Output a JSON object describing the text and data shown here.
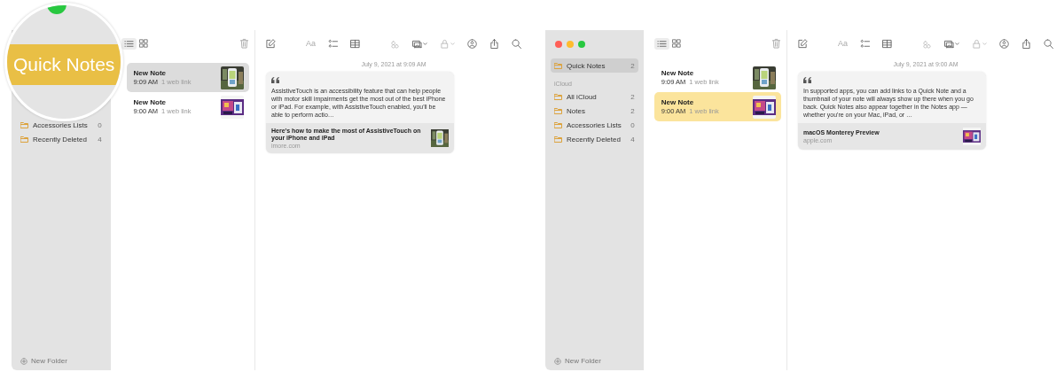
{
  "windows": [
    {
      "focused": false,
      "window_controls": false,
      "magnifier": {
        "label": "Quick Notes"
      },
      "sidebar": {
        "items": [
          {
            "kind": "folder",
            "label": "Accessories Lists",
            "count": "0",
            "selected": false
          },
          {
            "kind": "folder",
            "label": "Recently Deleted",
            "count": "4",
            "selected": false
          }
        ],
        "new_folder": "New Folder"
      },
      "note_list": {
        "list_view_selected": true,
        "notes": [
          {
            "title": "New Note",
            "time": "9:09 AM",
            "meta": "1 web link",
            "selected": true
          },
          {
            "title": "New Note",
            "time": "9:00 AM",
            "meta": "1 web link",
            "selected": false
          }
        ]
      },
      "editor": {
        "format_label": "Aa",
        "date": "July 9, 2021 at 9:09 AM",
        "card": {
          "excerpt": "AssistiveTouch is an accessibility feature that can help people with motor skill impairments get the most out of the best iPhone or iPad. For example, with AssistiveTouch enabled, you'll be able to perform actio…",
          "title": "Here's how to make the most of AssistiveTouch on your iPhone and iPad",
          "domain": "imore.com"
        }
      }
    },
    {
      "focused": true,
      "window_controls": true,
      "sidebar": {
        "items": [
          {
            "kind": "folder",
            "label": "Quick Notes",
            "count": "2",
            "selected": true
          },
          {
            "kind": "header",
            "label": "iCloud"
          },
          {
            "kind": "folder",
            "label": "All iCloud",
            "count": "2",
            "selected": false
          },
          {
            "kind": "folder",
            "label": "Notes",
            "count": "2",
            "selected": false
          },
          {
            "kind": "folder",
            "label": "Accessories Lists",
            "count": "0",
            "selected": false
          },
          {
            "kind": "folder",
            "label": "Recently Deleted",
            "count": "4",
            "selected": false
          }
        ],
        "new_folder": "New Folder"
      },
      "note_list": {
        "list_view_selected": true,
        "notes": [
          {
            "title": "New Note",
            "time": "9:09 AM",
            "meta": "1 web link",
            "selected": false
          },
          {
            "title": "New Note",
            "time": "9:00 AM",
            "meta": "1 web link",
            "selected": true
          }
        ]
      },
      "editor": {
        "format_label": "Aa",
        "date": "July 9, 2021 at 9:00 AM",
        "card": {
          "excerpt": "In supported apps, you can add links to a Quick Note and a thumbnail of your note will always show up there when you go back. Quick Notes also appear together in the Notes app — whether you're on your Mac, iPad, or …",
          "title": "macOS Monterey Preview",
          "domain": "apple.com"
        }
      }
    }
  ]
}
